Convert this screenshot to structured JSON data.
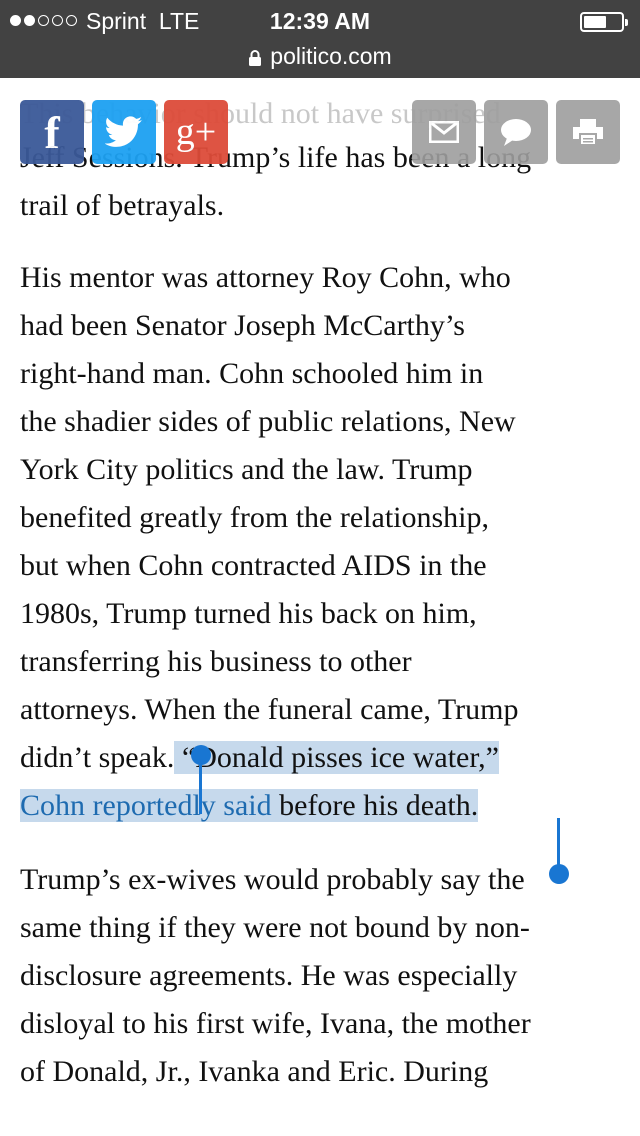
{
  "status_bar": {
    "carrier": "Sprint",
    "network": "LTE",
    "time": "12:39 AM",
    "signal_bars": 2
  },
  "url_bar": {
    "domain": "politico.com"
  },
  "share_bar": {
    "facebook_glyph": "f",
    "twitter_icon": "twitter-bird-icon",
    "googleplus_glyph": "g+",
    "email_icon": "envelope-icon",
    "comment_icon": "speech-bubble-icon",
    "print_icon": "printer-icon"
  },
  "article": {
    "ghost_line": "This behavior should not have surprised",
    "para1_line1": "Jeff Sessions. Trump’s life has been a long",
    "para1_line2": "trail of betrayals.",
    "para2_lines": [
      "His mentor was attorney Roy Cohn, who",
      "had been Senator Joseph McCarthy’s",
      "right-hand man. Cohn schooled him in",
      "the shadier sides of public relations, New",
      "York City politics and the law. Trump",
      "benefited greatly from the relationship,",
      "but when Cohn contracted AIDS in the",
      "1980s, Trump turned his back on him,",
      "transferring his business to other",
      "attorneys. When the funeral came, Trump"
    ],
    "para2_line11_before": "didn’t speak.",
    "para2_line11_selected": " “Donald pisses ice water,”",
    "para2_line12_link": "Cohn reportedly said",
    "para2_line12_rest": " before his death.",
    "para3_lines": [
      "Trump’s ex-wives would probably say the",
      "same thing if they were not bound by non-",
      "disclosure agreements. He was especially",
      "disloyal to his first wife, Ivana, the mother",
      "of Donald, Jr., Ivanka and Eric. During"
    ]
  },
  "colors": {
    "status_bg": "#424242",
    "selection": "#c6d9ec",
    "link": "#1e6bb0",
    "handle": "#1976d2",
    "facebook": "#3b5998",
    "twitter": "#1da1f2",
    "googleplus": "#dd4b39",
    "tool_gray": "#9e9e9e"
  }
}
